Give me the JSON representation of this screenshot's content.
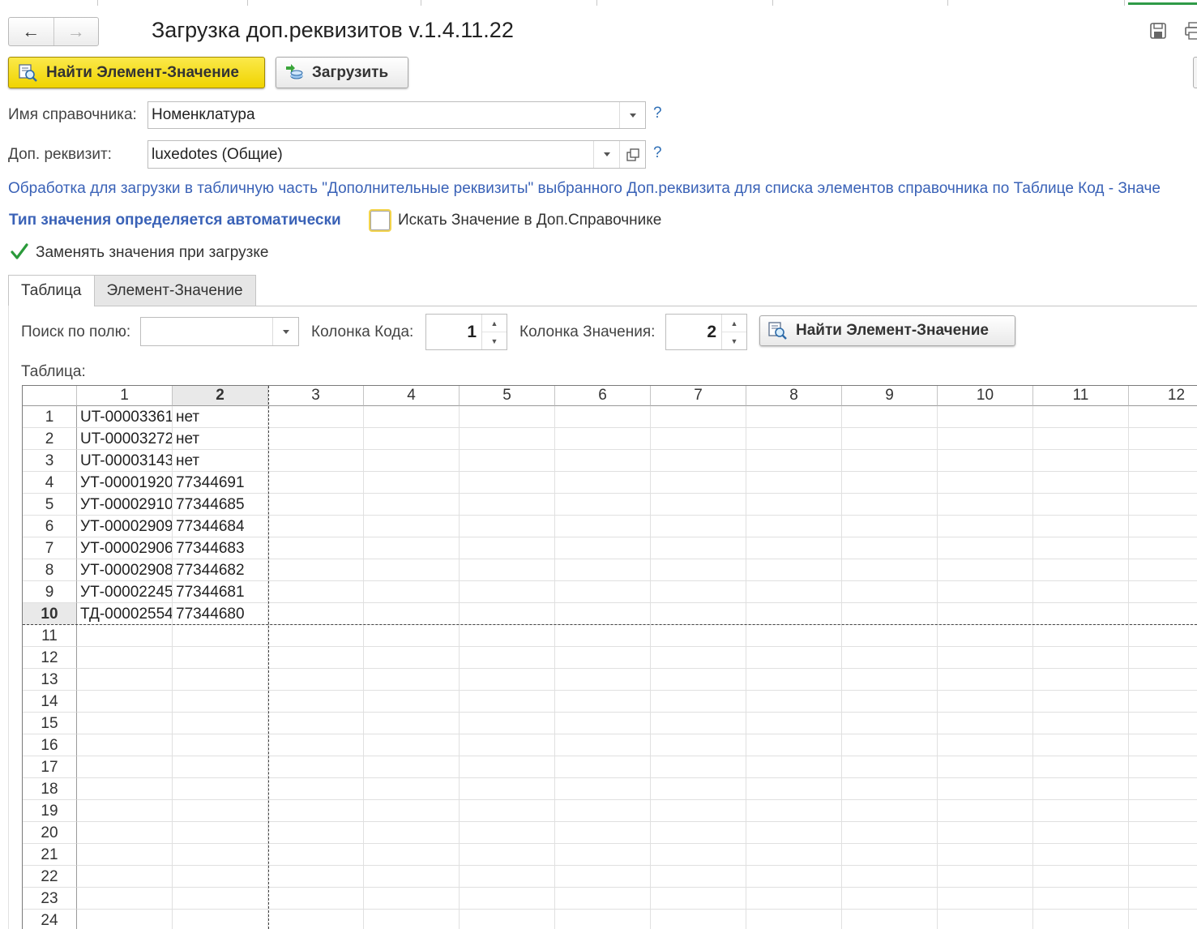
{
  "window": {
    "title": "Загрузка доп.реквизитов v.1.4.11.22",
    "back_arrow": "←",
    "forward_arrow": "→"
  },
  "toolbar": {
    "find_button": "Найти Элемент-Значение",
    "load_button": "Загрузить"
  },
  "form": {
    "catalog_label": "Имя справочника:",
    "catalog_value": "Номенклатура",
    "attribute_label": "Доп. реквизит:",
    "attribute_value": "luxedotes (Общие)",
    "help": "?",
    "info_text": "Обработка для загрузки в табличную часть \"Дополнительные реквизиты\" выбранного Доп.реквизита для списка элементов справочника по Таблице Код - Значе",
    "type_text": "Тип значения определяется автоматически",
    "search_in_catalog_label": "Искать Значение в Доп.Справочнике",
    "search_in_catalog_checked": false,
    "replace_label": "Заменять значения при загрузке",
    "replace_checked": true
  },
  "tabs": [
    {
      "label": "Таблица",
      "active": true
    },
    {
      "label": "Элемент-Значение",
      "active": false
    }
  ],
  "table_tab": {
    "search_field_label": "Поиск по полю:",
    "search_field_value": "",
    "code_column_label": "Колонка Кода:",
    "code_column_value": "1",
    "value_column_label": "Колонка Значения:",
    "value_column_value": "2",
    "find_button": "Найти Элемент-Значение",
    "table_label": "Таблица:"
  },
  "grid": {
    "columns": [
      "1",
      "2",
      "3",
      "4",
      "5",
      "6",
      "7",
      "8",
      "9",
      "10",
      "11",
      "12"
    ],
    "selected_column": "2",
    "selected_row": "10",
    "rows": [
      {
        "n": "1",
        "c1": "UT-00003361",
        "c2": "нет"
      },
      {
        "n": "2",
        "c1": "UT-00003272",
        "c2": "нет"
      },
      {
        "n": "3",
        "c1": "UT-00003143",
        "c2": "нет"
      },
      {
        "n": "4",
        "c1": "УТ-00001920",
        "c2": "77344691"
      },
      {
        "n": "5",
        "c1": "УТ-00002910",
        "c2": "77344685"
      },
      {
        "n": "6",
        "c1": "УТ-00002909",
        "c2": "77344684"
      },
      {
        "n": "7",
        "c1": "УТ-00002906",
        "c2": "77344683"
      },
      {
        "n": "8",
        "c1": "УТ-00002908",
        "c2": "77344682"
      },
      {
        "n": "9",
        "c1": "УТ-00002245",
        "c2": "77344681"
      },
      {
        "n": "10",
        "c1": "ТД-00002554",
        "c2": "77344680"
      },
      {
        "n": "11",
        "c1": "",
        "c2": ""
      },
      {
        "n": "12",
        "c1": "",
        "c2": ""
      },
      {
        "n": "13",
        "c1": "",
        "c2": ""
      },
      {
        "n": "14",
        "c1": "",
        "c2": ""
      },
      {
        "n": "15",
        "c1": "",
        "c2": ""
      },
      {
        "n": "16",
        "c1": "",
        "c2": ""
      },
      {
        "n": "17",
        "c1": "",
        "c2": ""
      },
      {
        "n": "18",
        "c1": "",
        "c2": ""
      },
      {
        "n": "19",
        "c1": "",
        "c2": ""
      },
      {
        "n": "20",
        "c1": "",
        "c2": ""
      },
      {
        "n": "21",
        "c1": "",
        "c2": ""
      },
      {
        "n": "22",
        "c1": "",
        "c2": ""
      },
      {
        "n": "23",
        "c1": "",
        "c2": ""
      },
      {
        "n": "24",
        "c1": "",
        "c2": ""
      }
    ]
  },
  "colors": {
    "primary_button": "#f5dc1a",
    "link_blue": "#3a62b7",
    "check_green": "#2a9a3a",
    "active_tab_line": "#2f9a47"
  },
  "icons": [
    "save-icon",
    "print-icon",
    "find-element-icon",
    "load-icon",
    "dropdown-icon",
    "open-icon",
    "check-icon"
  ]
}
